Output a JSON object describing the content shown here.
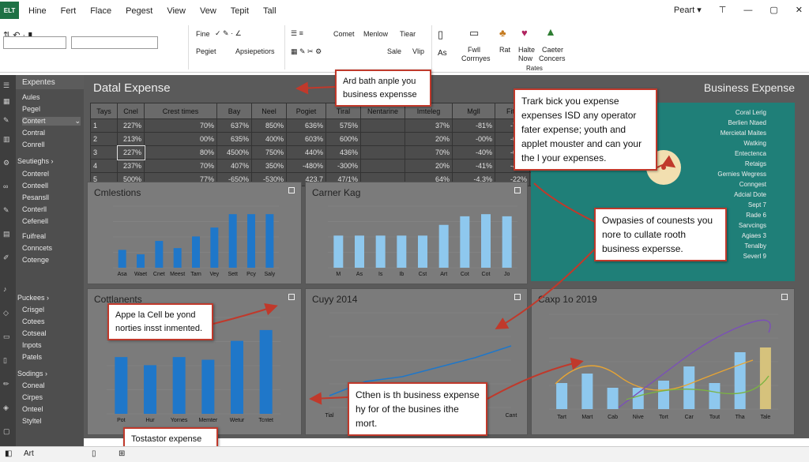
{
  "app": {
    "icon_label": "ELT",
    "menu": [
      "Hine",
      "Fert",
      "Flace",
      "Pegest",
      "View",
      "Vew",
      "Tepit",
      "Tall"
    ],
    "right_label": "Peart ▾"
  },
  "ribbon": {
    "row1": [
      "Fine",
      "Comet",
      "Menlow",
      "Tiear",
      "Fwll",
      "Corrnyes",
      "Rat",
      "Halte",
      "Now",
      "Caeter",
      "Concers"
    ],
    "row2": [
      "Pegiet",
      "Apsiepetiors",
      "Sale",
      "Vlip",
      "Rates"
    ],
    "namebox": "Dle"
  },
  "sidebar": {
    "header": "Expentes",
    "items1": [
      "Aules",
      "Pegel",
      "Contert",
      "Contral",
      "Conrell"
    ],
    "section2": "Seutieghs",
    "items2": [
      "Conterel",
      "Conteell",
      "Pesansll",
      "Conterll",
      "Cefenell",
      "Fuifreal",
      "Conncets",
      "Cotenge"
    ],
    "section3": "Puckees",
    "items3": [
      "Crisgel",
      "Cotees",
      "Cotseal",
      "Inpots",
      "Patels"
    ],
    "section4": "Sodings",
    "items4": [
      "Coneal",
      "Cirpes",
      "Onteel",
      "Styltel"
    ]
  },
  "main": {
    "title": "Datal Expense",
    "right_title": "Business Expense",
    "table": {
      "headers": [
        "Tays",
        "Cnel",
        "Crest times",
        "Bay",
        "Neel",
        "Pogiet",
        "Tiral",
        "Nentarine",
        "Imteleg",
        "Mgll",
        "Fite",
        "Stgil",
        "Cror"
      ],
      "rows": [
        [
          "1",
          "227%",
          "70%",
          "637%",
          "850%",
          "636%",
          "575%",
          "",
          "37%",
          "-81%",
          "-70%",
          "-537%",
          "-75%"
        ],
        [
          "2",
          "213%",
          "00%",
          "635%",
          "400%",
          "603%",
          "600%",
          "",
          "20%",
          "-00%",
          "-00%",
          "-00%",
          "-75%"
        ],
        [
          "3",
          "227%",
          "80%",
          "4500%",
          "750%",
          "440%",
          "436%",
          "",
          "70%",
          "-40%",
          "-07%",
          "-42%",
          "-75%"
        ],
        [
          "4",
          "237%",
          "70%",
          "407%",
          "350%",
          "-480%",
          "-300%",
          "",
          "20%",
          "-41%",
          "-45%",
          "-07%",
          "-57%"
        ],
        [
          "5",
          "500%",
          "77%",
          "-650%",
          "-530%",
          "423.7",
          "47/1%",
          "",
          "64%",
          "-4.3%",
          "-22%",
          "-57%",
          "-57%"
        ]
      ]
    }
  },
  "panels": {
    "p1": {
      "title": "Cmlestions"
    },
    "p2": {
      "title": "Carner Kag"
    },
    "p3": {
      "title": "Cottlanents"
    },
    "p4": {
      "title": "Cuyy 2014"
    },
    "p5": {
      "title": "Caxp 1o 2019"
    }
  },
  "teal": {
    "items": [
      "Coral Lerig",
      "Berlien Ntaed",
      "Mercietal Maites",
      "Watking",
      "Entectenca",
      "Retaigs",
      "Gernies Wegress",
      "Conngest",
      "Adcial Dote",
      "Sept 7",
      "Rade 6",
      "Sarvcings",
      "Agiaes 3",
      "Tenalby",
      "Severl 9"
    ]
  },
  "callouts": {
    "c1": "Ard bath anple you business expensse",
    "c2": "Trark bick you expense expenses ISD any operator fater expense; youth and applet mouster and can your the l your expenses.",
    "c3": "Owpasies of counests you nore to cullate rooth business expersse.",
    "c4": "Appe la Cell be yond norties insst inmented.",
    "c5": "Cthen is th business expense hy for of the busines ithe mort.",
    "c6": "Tostastor expense"
  },
  "chart_data": [
    {
      "type": "bar",
      "categories": [
        "Asa",
        "Waet",
        "Cnet",
        "Meest",
        "Tarn",
        "Vey",
        "Sett",
        "Pcy",
        "Saly"
      ],
      "values": [
        20,
        15,
        30,
        22,
        35,
        45,
        60,
        60,
        60
      ],
      "ylim": [
        0,
        1320
      ]
    },
    {
      "type": "bar",
      "categories": [
        "M",
        "As",
        "Is",
        "Ib",
        "Cst",
        "Art",
        "Cot",
        "Cot",
        "Jo"
      ],
      "values": [
        30,
        30,
        30,
        30,
        30,
        40,
        48,
        50,
        48
      ],
      "ylim": [
        0,
        160
      ]
    },
    {
      "type": "bar",
      "categories": [
        "Pot",
        "Hur",
        "Yornes",
        "Memter",
        "Wetur",
        "Tcntet"
      ],
      "values": [
        210,
        180,
        210,
        200,
        270,
        310
      ],
      "ylim": [
        0,
        400
      ]
    },
    {
      "type": "line",
      "x": [
        "Tial",
        "Man",
        "Jun",
        "Iull",
        "Cunt",
        "Cant"
      ],
      "values": [
        50,
        110,
        130,
        170,
        210,
        260
      ],
      "ylim": [
        0,
        400
      ]
    },
    {
      "type": "bar",
      "categories": [
        "Tart",
        "Mart",
        "Cab",
        "Nive",
        "Tort",
        "Car",
        "Tout",
        "Tha",
        "Tale"
      ],
      "values": [
        110,
        150,
        90,
        90,
        120,
        180,
        110,
        240,
        260
      ],
      "ylim": [
        0,
        400
      ]
    }
  ],
  "status": {
    "sheet": "Art"
  }
}
